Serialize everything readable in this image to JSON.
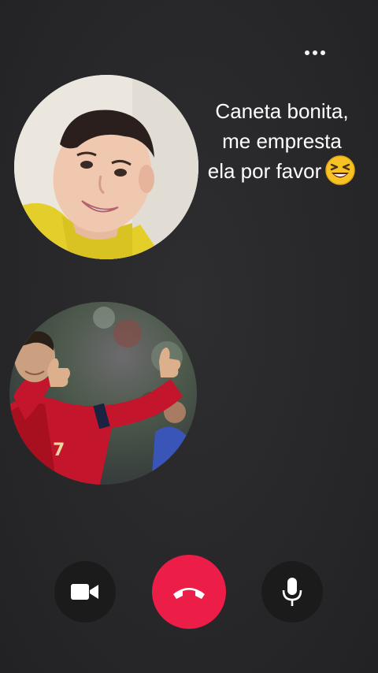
{
  "header": {
    "more_icon": "more-horizontal-icon"
  },
  "participants": [
    {
      "role": "caller",
      "icon": "avatar-photo"
    },
    {
      "role": "callee",
      "icon": "avatar-photo"
    }
  ],
  "message": {
    "lines": [
      "Caneta bonita,",
      "me empresta",
      "ela por favor"
    ],
    "emoji": "laughing-face-emoji"
  },
  "controls": {
    "video_icon": "video-camera-icon",
    "end_call_icon": "phone-hangup-icon",
    "mic_icon": "microphone-icon"
  },
  "colors": {
    "background": "#29292b",
    "end_call": "#ec1d46",
    "control_bg": "#1b1b1c",
    "text": "#ffffff"
  }
}
